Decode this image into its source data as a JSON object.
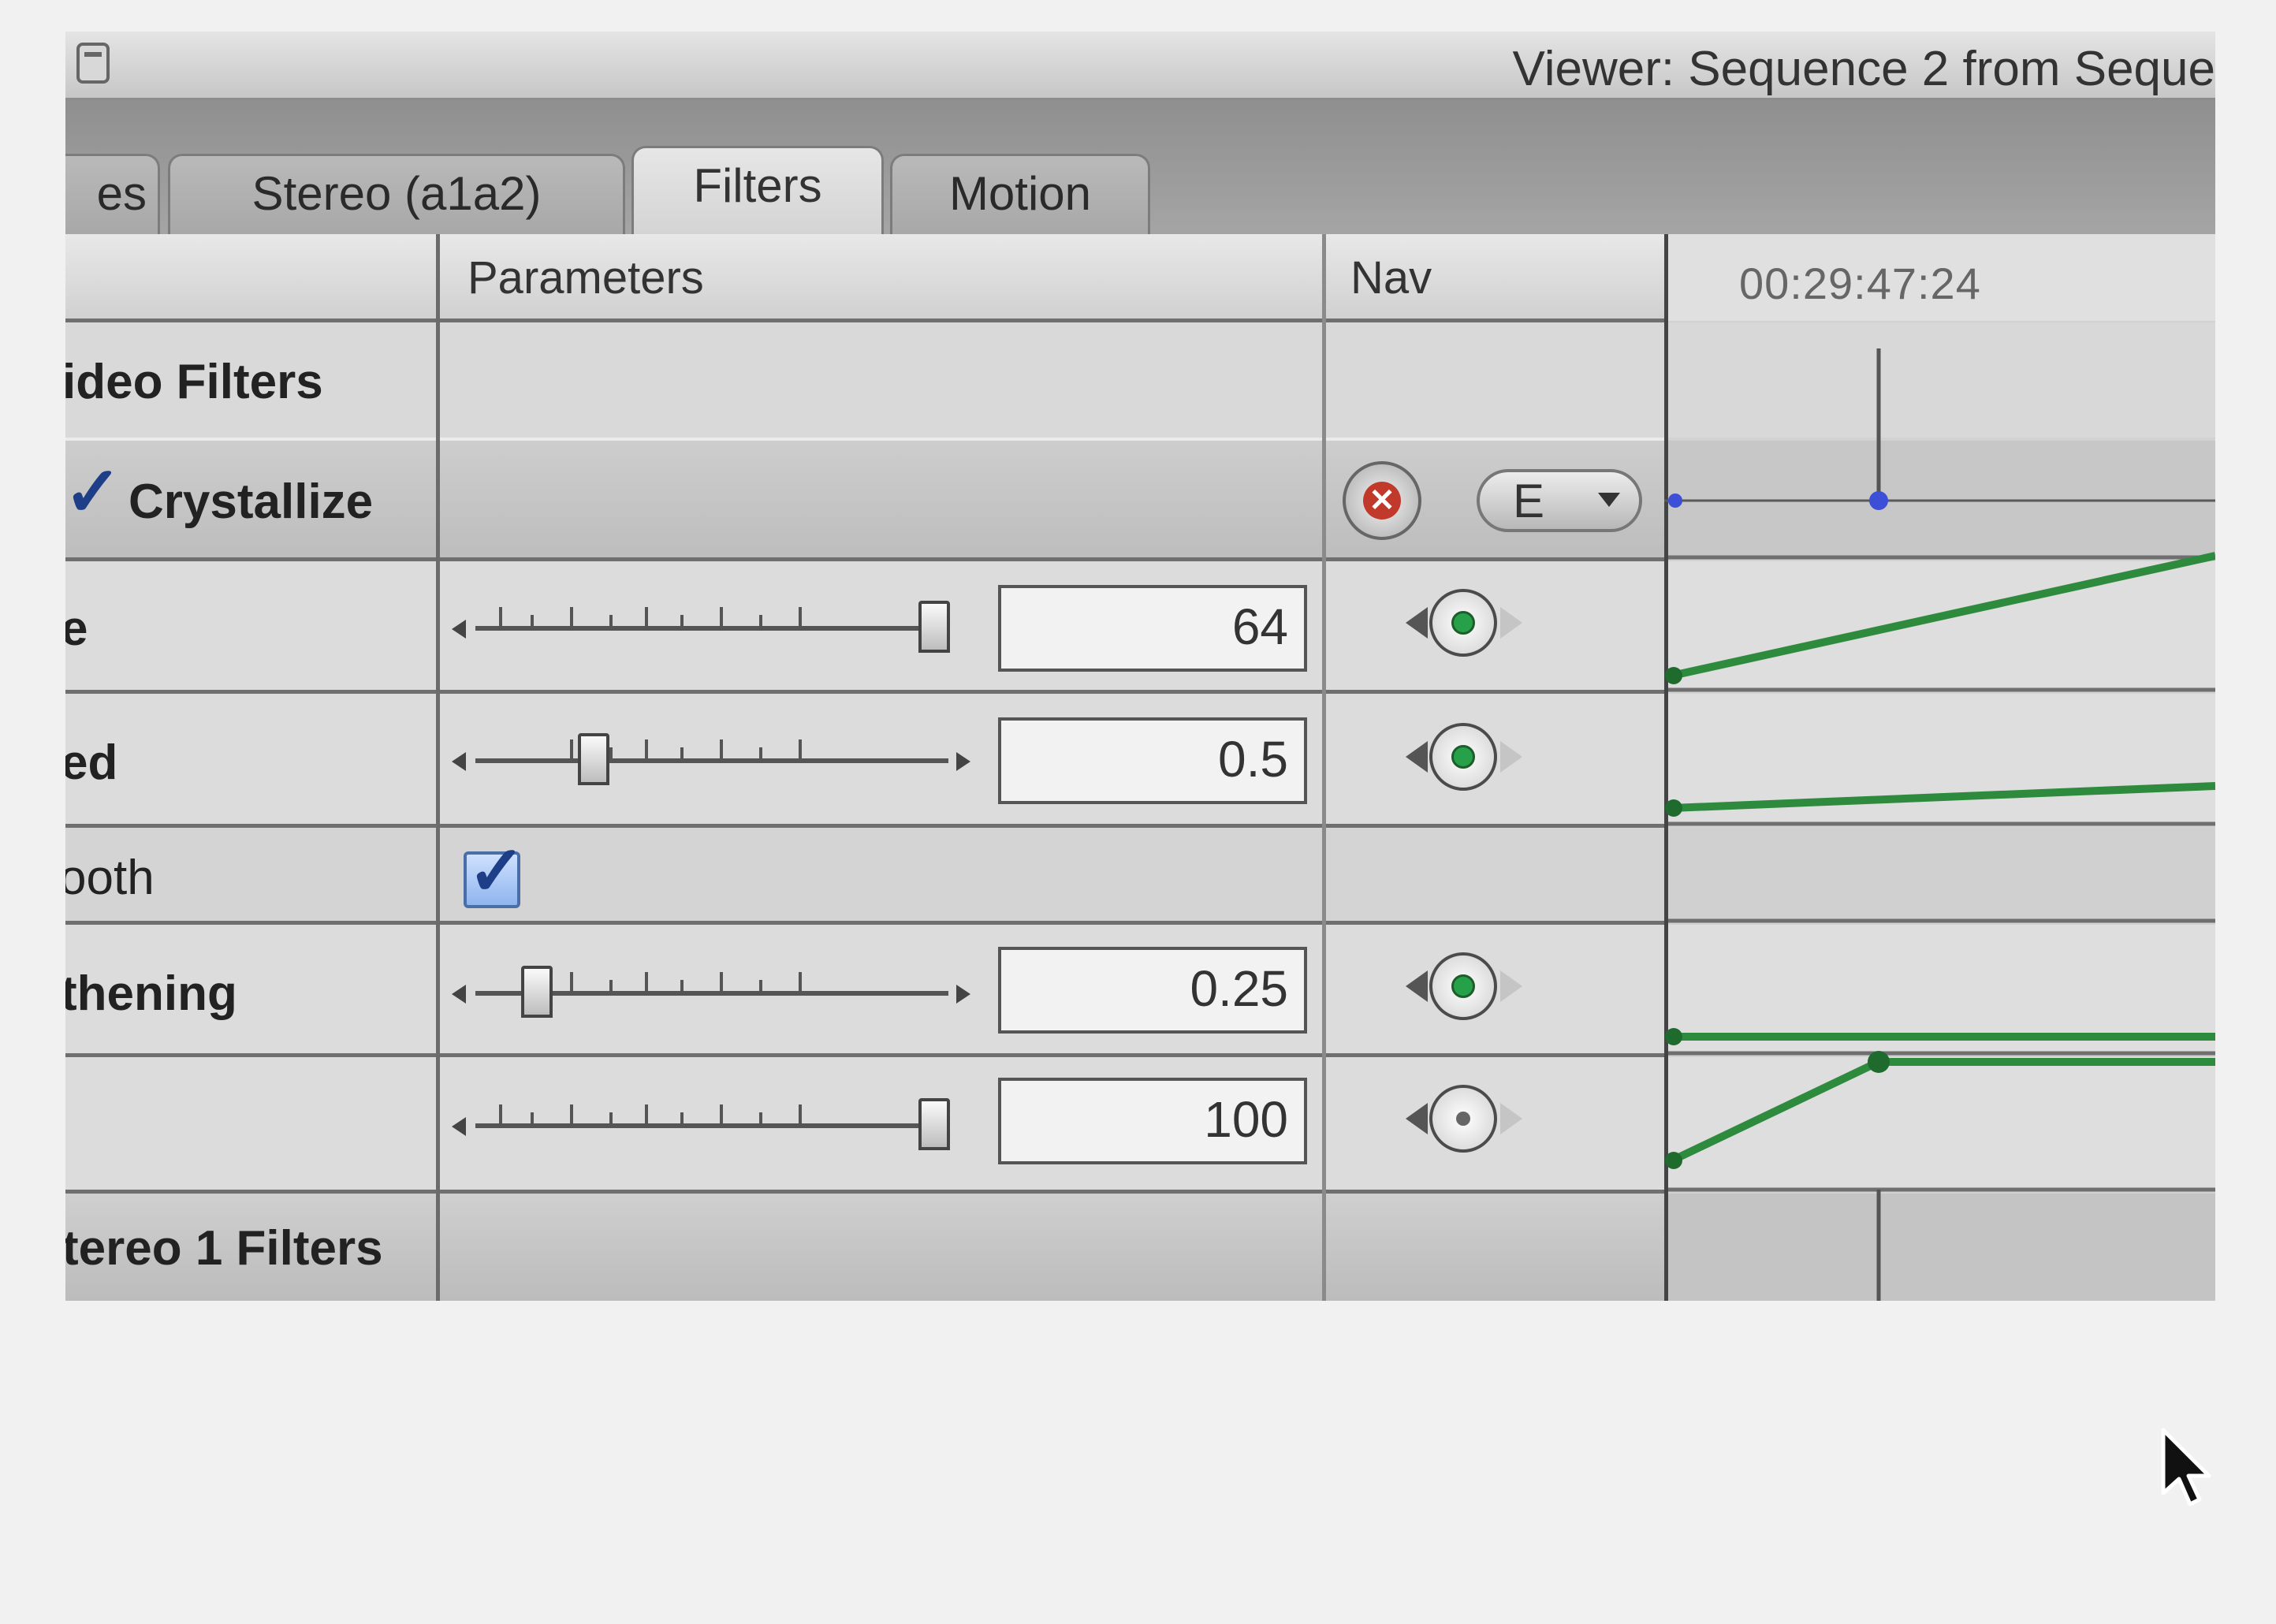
{
  "window": {
    "title": "Viewer: Sequence 2 from Seque"
  },
  "tabs": [
    {
      "label": "es",
      "active": false
    },
    {
      "label": "Stereo (a1a2)",
      "active": false
    },
    {
      "label": "Filters",
      "active": true
    },
    {
      "label": "Motion",
      "active": false
    }
  ],
  "columns": {
    "name": "",
    "parameters": "Parameters",
    "nav": "Nav",
    "timecode": "00:29:47:24"
  },
  "rows": {
    "video_filters": "ideo Filters",
    "crystallize": {
      "label": "Crystallize",
      "checked": true,
      "menu_value": "E"
    },
    "param1": {
      "label": "e",
      "value": "64",
      "slider_fraction": 0.97
    },
    "param2": {
      "label": "ed",
      "value": "0.5",
      "slider_fraction": 0.25
    },
    "param3": {
      "label": "ooth",
      "checked": true
    },
    "param4": {
      "label": "thening",
      "value": "0.25",
      "slider_fraction": 0.13
    },
    "param5": {
      "label": "",
      "value": "100",
      "slider_fraction": 0.97
    },
    "stereo_filters": "tereo 1 Filters"
  },
  "colors": {
    "keyframe_green": "#27a04a",
    "keyframe_blue": "#3c4fd6",
    "reset_red": "#c0392b"
  }
}
